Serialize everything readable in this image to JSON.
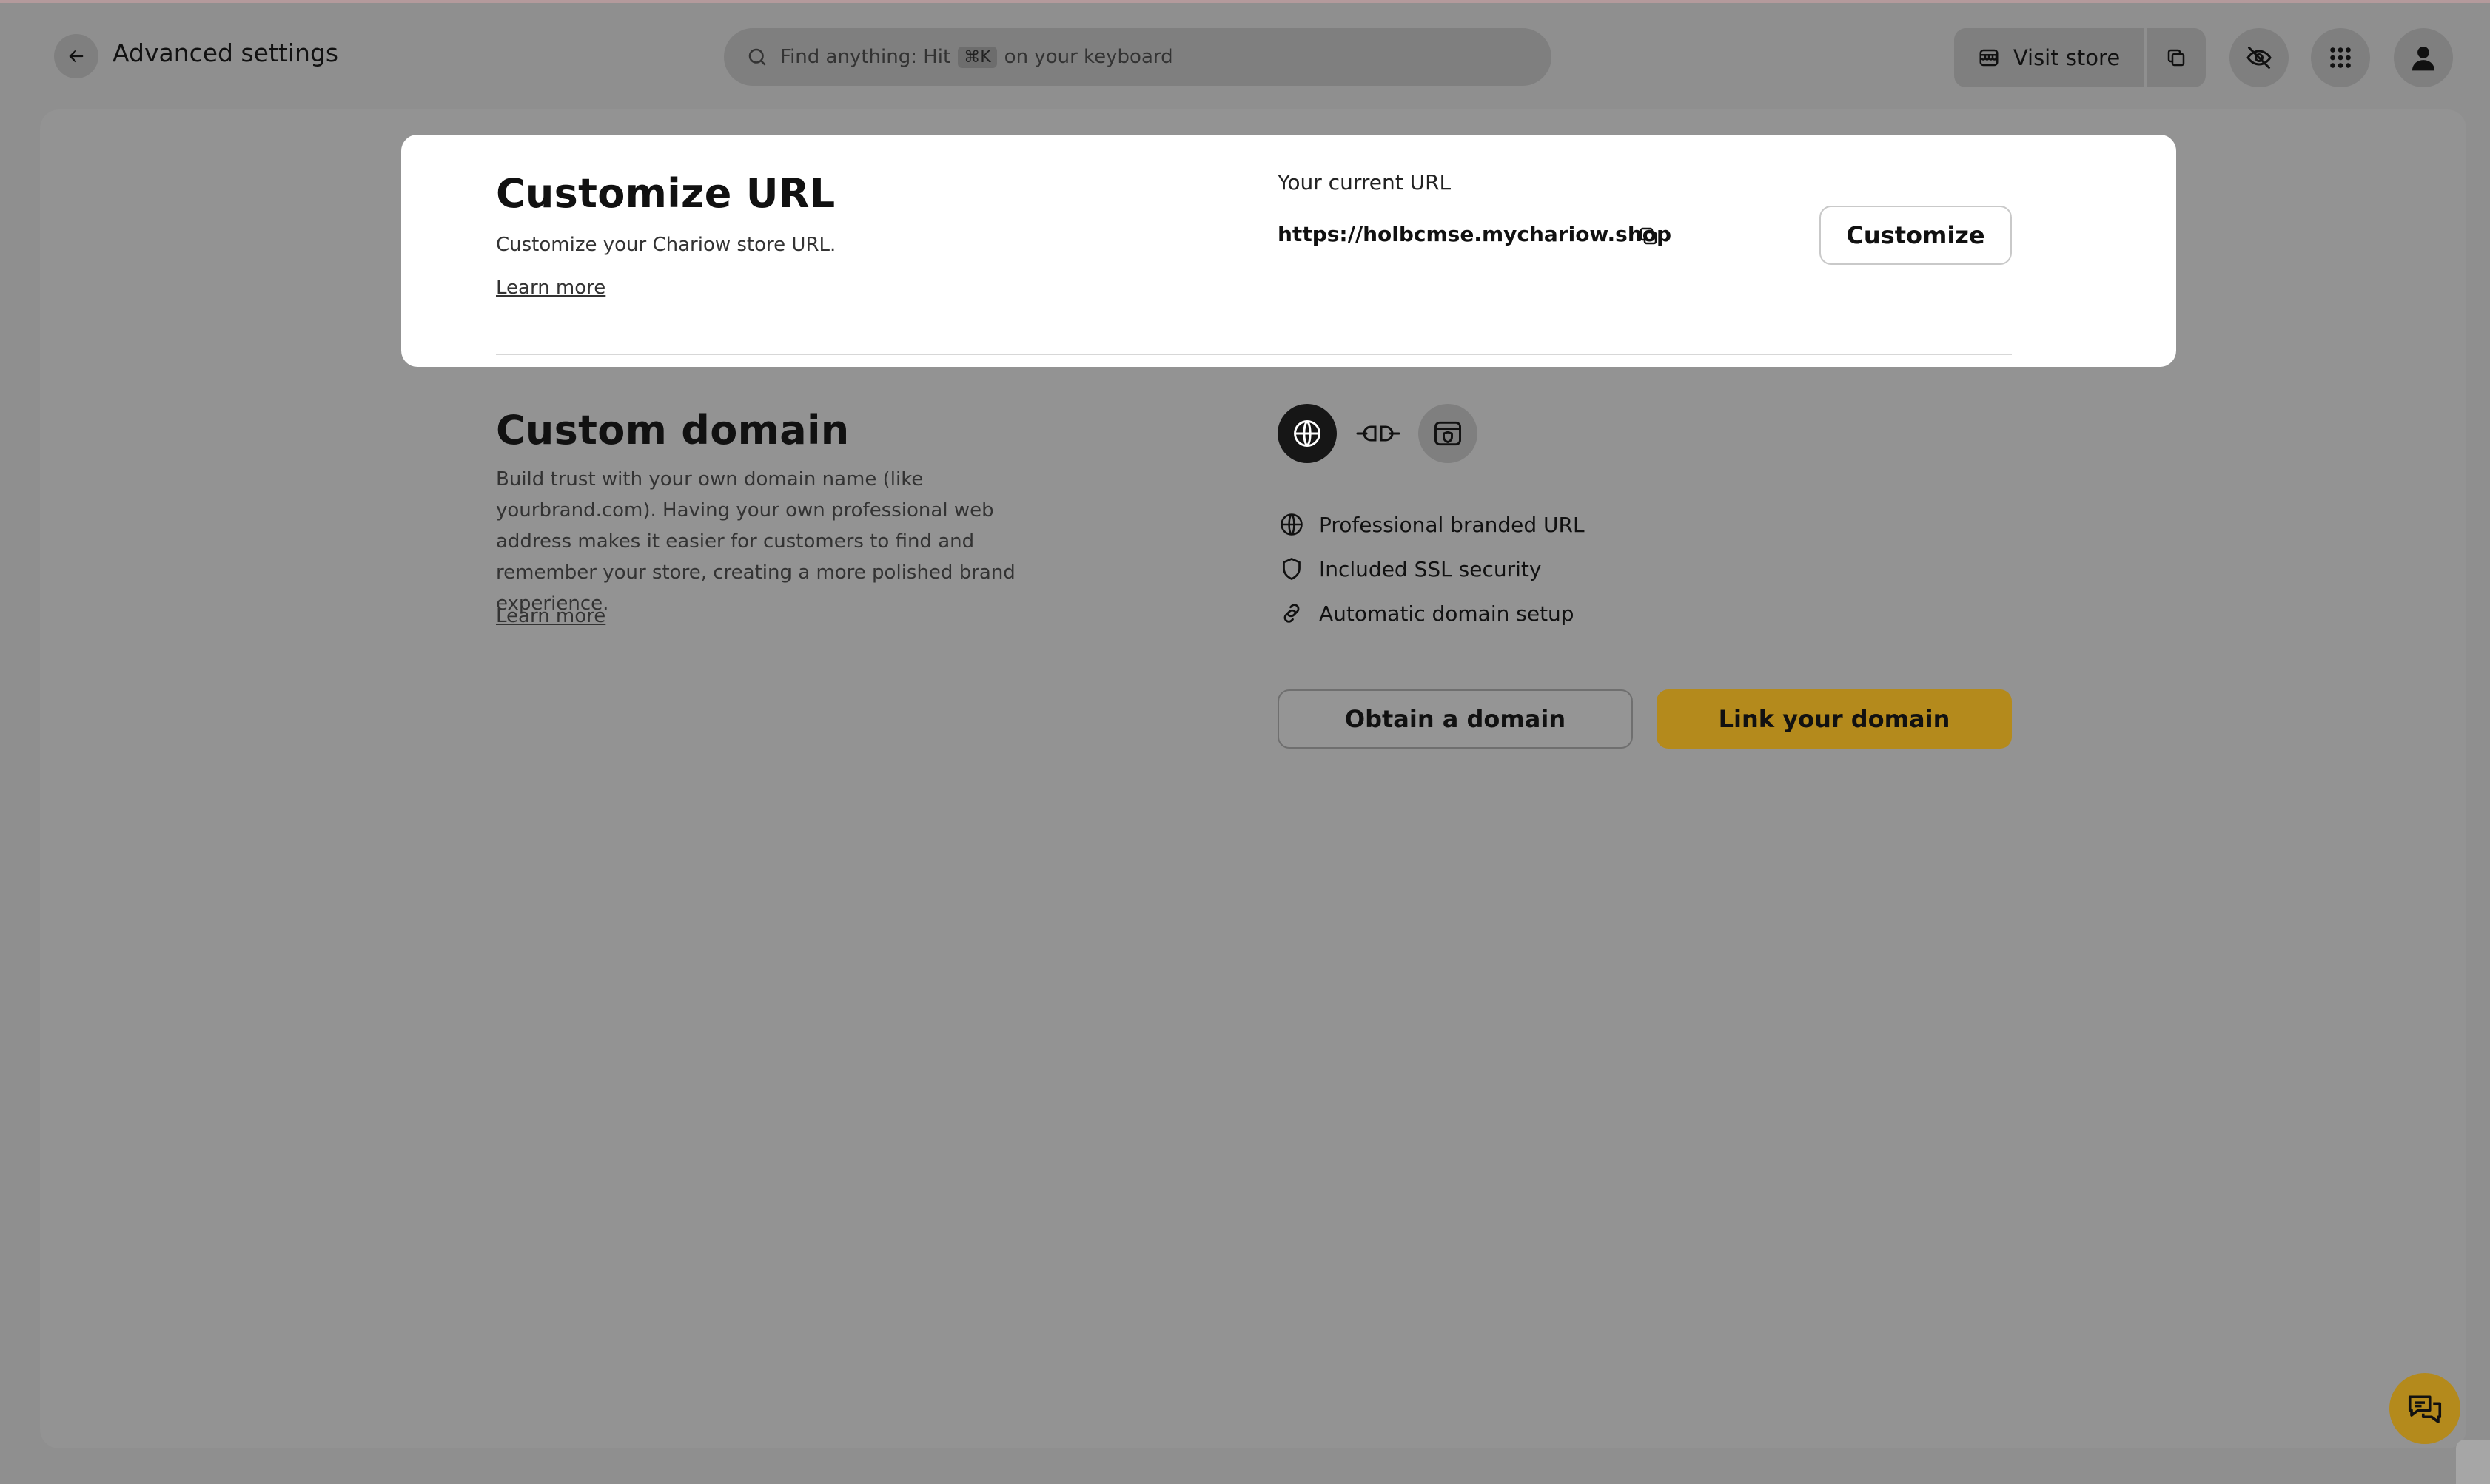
{
  "header": {
    "title": "Advanced settings",
    "search_placeholder": "Find anything: Hit",
    "search_shortcut": "⌘K",
    "search_suffix": "on your keyboard",
    "visit_store_label": "Visit store"
  },
  "customize_url": {
    "title": "Customize URL",
    "description": "Customize your Chariow store URL.",
    "learn_more": "Learn more",
    "current_url_label": "Your current URL",
    "current_url": "https://holbcmse.mychariow.shop",
    "customize_button": "Customize"
  },
  "custom_domain": {
    "title": "Custom domain",
    "description": "Build trust with your own domain name (like yourbrand.com). Having your own professional web address makes it easier for customers to find and remember your store, creating a more polished brand experience.",
    "learn_more": "Learn more",
    "features": [
      {
        "label": "Professional branded URL",
        "icon": "globe-icon"
      },
      {
        "label": "Included SSL security",
        "icon": "shield-icon"
      },
      {
        "label": "Automatic domain setup",
        "icon": "link-icon"
      }
    ],
    "obtain_button": "Obtain a domain",
    "link_button": "Link your domain"
  },
  "colors": {
    "accent": "#b48a1c",
    "overlay_bg": "#8f8f8f",
    "card_bg": "#ffffff"
  }
}
